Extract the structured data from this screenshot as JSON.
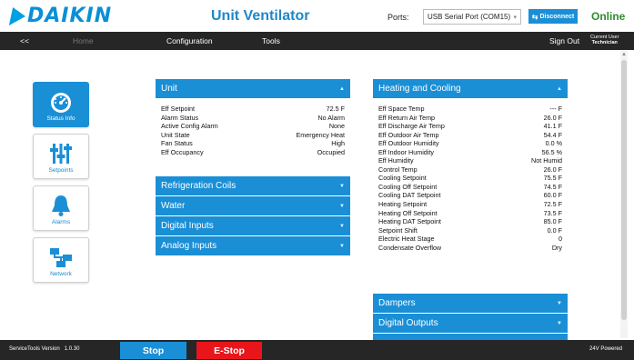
{
  "header": {
    "logo_text": "DAIKIN",
    "title": "Unit Ventilator",
    "ports_label": "Ports:",
    "ports_value": "USB Serial Port (COM15)",
    "disconnect_label": "Disconnect",
    "status": "Online"
  },
  "nav": {
    "back": "<<",
    "home": "Home",
    "configuration": "Configuration",
    "tools": "Tools",
    "sign_out": "Sign Out",
    "current_user_label": "Current User",
    "current_user": "Technician"
  },
  "sidebar": {
    "items": [
      {
        "label": "Status Info",
        "icon": "gauge-icon",
        "active": true
      },
      {
        "label": "Setpoints",
        "icon": "sliders-icon",
        "active": false
      },
      {
        "label": "Alarms",
        "icon": "bell-icon",
        "active": false
      },
      {
        "label": "Network",
        "icon": "network-icon",
        "active": false
      }
    ]
  },
  "left_panels": {
    "unit": {
      "title": "Unit",
      "rows": [
        {
          "k": "Eff Setpoint",
          "v": "72.5 F"
        },
        {
          "k": "Alarm Status",
          "v": "No Alarm"
        },
        {
          "k": "Active Config Alarm",
          "v": "None"
        },
        {
          "k": "Unit State",
          "v": "Emergency Heat"
        },
        {
          "k": "Fan Status",
          "v": "High"
        },
        {
          "k": "Eff Occupancy",
          "v": "Occupied"
        }
      ]
    },
    "collapsed": [
      {
        "title": "Refrigeration Coils"
      },
      {
        "title": "Water"
      },
      {
        "title": "Digital Inputs"
      },
      {
        "title": "Analog Inputs"
      }
    ]
  },
  "right_panels": {
    "heating_cooling": {
      "title": "Heating and Cooling",
      "rows": [
        {
          "k": "Eff Space Temp",
          "v": "--- F"
        },
        {
          "k": "Eff Return Air Temp",
          "v": "26.0 F"
        },
        {
          "k": "Eff Discharge Air Temp",
          "v": "41.1 F"
        },
        {
          "k": "Eff Outdoor Air Temp",
          "v": "54.4 F"
        },
        {
          "k": "Eff Outdoor Humidity",
          "v": "0.0 %"
        },
        {
          "k": "Eff Indoor Humidity",
          "v": "56.5 %"
        },
        {
          "k": "Eff Humidity",
          "v": "Not Humid"
        },
        {
          "k": "Control Temp",
          "v": "26.0 F"
        },
        {
          "k": "Cooling Setpoint",
          "v": "75.5 F"
        },
        {
          "k": "Cooling Off Setpoint",
          "v": "74.5 F"
        },
        {
          "k": "Cooling DAT Setpoint",
          "v": "60.0 F"
        },
        {
          "k": "Heating Setpoint",
          "v": "72.5 F"
        },
        {
          "k": "Heating Off Setpoint",
          "v": "73.5 F"
        },
        {
          "k": "Heating DAT Setpoint",
          "v": "85.0 F"
        },
        {
          "k": "Setpoint Shift",
          "v": "0.0 F"
        },
        {
          "k": "Electric Heat Stage",
          "v": "0"
        },
        {
          "k": "Condensate Overflow",
          "v": "Dry"
        }
      ]
    },
    "collapsed": [
      {
        "title": "Dampers"
      },
      {
        "title": "Digital Outputs"
      }
    ]
  },
  "footer": {
    "version_label": "ServiceTools Version",
    "version": "1.0.30",
    "stop": "Stop",
    "estop": "E-Stop",
    "power": "24V Powered"
  },
  "colors": {
    "accent": "#1a8fd6",
    "nav_bg": "#262626",
    "online": "#2e8b2e",
    "estop": "#e8161b"
  }
}
